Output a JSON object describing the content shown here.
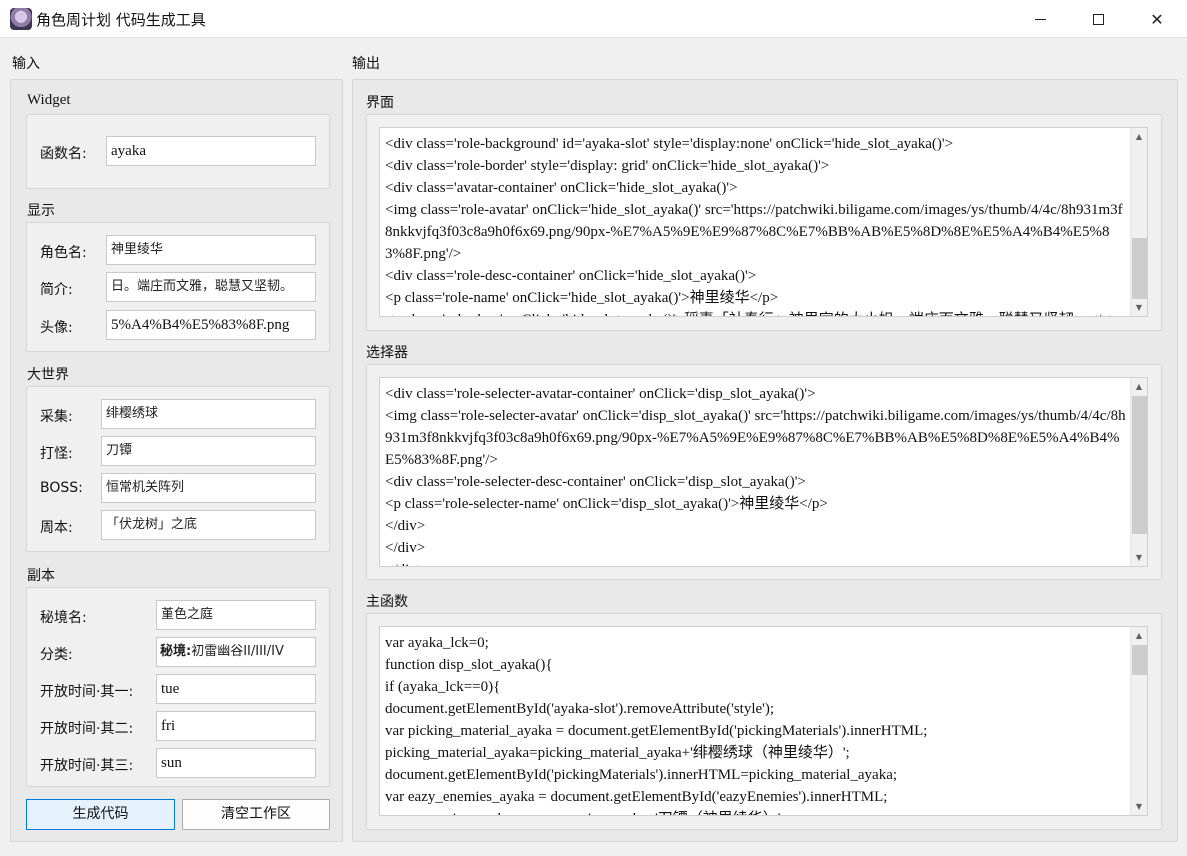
{
  "window": {
    "title": "角色周计划 代码生成工具",
    "minimize_icon": "minimize-icon",
    "maximize_icon": "maximize-icon",
    "close_icon": "close-icon",
    "close_glyph": "✕"
  },
  "input_panel": {
    "label": "输入",
    "widget": {
      "title": "Widget",
      "function_name_label": "函数名:",
      "function_name_value": "ayaka"
    },
    "display": {
      "title": "显示",
      "role_name_label": "角色名:",
      "role_name_value": "神里绫华",
      "intro_label": "简介:",
      "intro_value": "日。端庄而文雅，聪慧又坚韧。",
      "avatar_label": "头像:",
      "avatar_value": "5%A4%B4%E5%83%8F.png"
    },
    "overworld": {
      "title": "大世界",
      "gather_label": "采集:",
      "gather_value": "绯樱绣球",
      "monster_label": "打怪:",
      "monster_value": "刀镡",
      "boss_label": "BOSS:",
      "boss_value": "恒常机关阵列",
      "weekly_label": "周本:",
      "weekly_value": "「伏龙树」之底"
    },
    "dungeon": {
      "title": "副本",
      "domain_name_label": "秘境名:",
      "domain_name_value": "堇色之庭",
      "category_label": "分类:",
      "category_value_prefix": "秘境:",
      "category_value_rest": "初雷幽谷II/III/IV",
      "open1_label": "开放时间·其一:",
      "open1_value": "tue",
      "open2_label": "开放时间·其二:",
      "open2_value": "fri",
      "open3_label": "开放时间·其三:",
      "open3_value": "sun"
    },
    "buttons": {
      "generate": "生成代码",
      "clear": "清空工作区"
    }
  },
  "output_panel": {
    "label": "输出",
    "interface": {
      "title": "界面",
      "lines": [
        "<div class='role-background' id='ayaka-slot' style='display:none' onClick='hide_slot_ayaka()'>",
        "<div class='role-border' style='display: grid' onClick='hide_slot_ayaka()'>",
        "<div class='avatar-container' onClick='hide_slot_ayaka()'>",
        "<img class='role-avatar' onClick='hide_slot_ayaka()' src='https://patchwiki.biligame.com/images/ys/thumb/4/4c/8h931m3f8nkkvjfq3f03c8a9h0f6x69.png/90px-%E7%A5%9E%E9%87%8C%E7%BB%AB%E5%8D%8E%E5%A4%B4%E5%83%8F.png'/>",
        "<div class='role-desc-container' onClick='hide_slot_ayaka()'>",
        "<p class='role-name' onClick='hide_slot_ayaka()'>神里绫华</p>",
        "<p class='role-desc' onClick='hide_slot_ayaka()'>稻妻「社奉行」神里家的大小姐。端庄而文雅，聪慧又坚韧。</p>"
      ]
    },
    "selector": {
      "title": "选择器",
      "lines": [
        "<div class='role-selecter-avatar-container' onClick='disp_slot_ayaka()'>",
        "<img class='role-selecter-avatar' onClick='disp_slot_ayaka()' src='https://patchwiki.biligame.com/images/ys/thumb/4/4c/8h931m3f8nkkvjfq3f03c8a9h0f6x69.png/90px-%E7%A5%9E%E9%87%8C%E7%BB%AB%E5%8D%8E%E5%A4%B4%E5%83%8F.png'/>",
        "<div class='role-selecter-desc-container' onClick='disp_slot_ayaka()'>",
        "<p class='role-selecter-name' onClick='disp_slot_ayaka()'>神里绫华</p>",
        "</div>",
        "</div>",
        "</div>"
      ]
    },
    "main_function": {
      "title": "主函数",
      "lines": [
        "var ayaka_lck=0;",
        "function disp_slot_ayaka(){",
        "if (ayaka_lck==0){",
        "document.getElementById('ayaka-slot').removeAttribute('style');",
        "var picking_material_ayaka = document.getElementById('pickingMaterials').innerHTML;",
        "picking_material_ayaka=picking_material_ayaka+'绯樱绣球（神里绫华）';",
        "document.getElementById('pickingMaterials').innerHTML=picking_material_ayaka;",
        "var eazy_enemies_ayaka = document.getElementById('eazyEnemies').innerHTML;",
        "eazy_enemies_ayaka=eazy_enemies_ayaka+'刀镡（神里绫华）';"
      ]
    }
  }
}
